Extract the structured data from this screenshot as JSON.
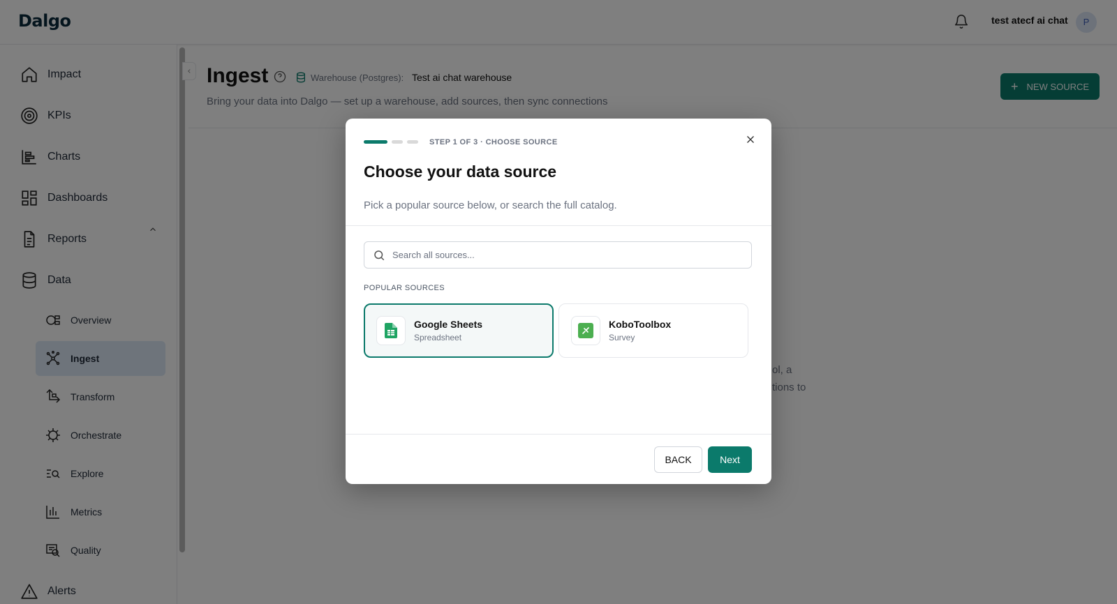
{
  "app": {
    "logo": "Dalgo"
  },
  "topbar": {
    "username": "test atecf ai chat",
    "avatar_initial": "P"
  },
  "sidebar": {
    "items": [
      {
        "label": "Impact",
        "icon": "home-icon"
      },
      {
        "label": "KPIs",
        "icon": "target-icon"
      },
      {
        "label": "Charts",
        "icon": "bar-chart-icon"
      },
      {
        "label": "Dashboards",
        "icon": "dashboard-grid-icon"
      },
      {
        "label": "Reports",
        "icon": "document-icon"
      },
      {
        "label": "Data",
        "icon": "database-icon"
      },
      {
        "label": "Alerts",
        "icon": "warning-triangle-icon"
      }
    ],
    "data_subitems": [
      {
        "label": "Overview",
        "icon": "overview-icon"
      },
      {
        "label": "Ingest",
        "icon": "ingest-icon",
        "active": true
      },
      {
        "label": "Transform",
        "icon": "transform-icon"
      },
      {
        "label": "Orchestrate",
        "icon": "orchestrate-icon"
      },
      {
        "label": "Explore",
        "icon": "explore-icon"
      },
      {
        "label": "Metrics",
        "icon": "metrics-icon"
      },
      {
        "label": "Quality",
        "icon": "quality-icon"
      }
    ]
  },
  "page": {
    "title": "Ingest",
    "warehouse_label": "Warehouse (Postgres):",
    "warehouse_name": "Test ai chat warehouse",
    "subtitle": "Bring your data into Dalgo — set up a warehouse, add sources, then sync connections",
    "new_source_label": "NEW SOURCE",
    "background_text_line1": "ol, a",
    "background_text_line2": "tions to"
  },
  "modal": {
    "step_text": "STEP 1 OF 3 · CHOOSE SOURCE",
    "title": "Choose your data source",
    "description": "Pick a popular source below, or search the full catalog.",
    "search_placeholder": "Search all sources...",
    "popular_label": "POPULAR SOURCES",
    "sources": [
      {
        "name": "Google Sheets",
        "type": "Spreadsheet",
        "selected": true,
        "color": "#1fa463"
      },
      {
        "name": "KoboToolbox",
        "type": "Survey",
        "selected": false,
        "color": "#4caf50"
      }
    ],
    "back_label": "BACK",
    "next_label": "Next"
  },
  "colors": {
    "accent": "#0b7a6b",
    "active_nav_bg": "#dde8f7"
  }
}
